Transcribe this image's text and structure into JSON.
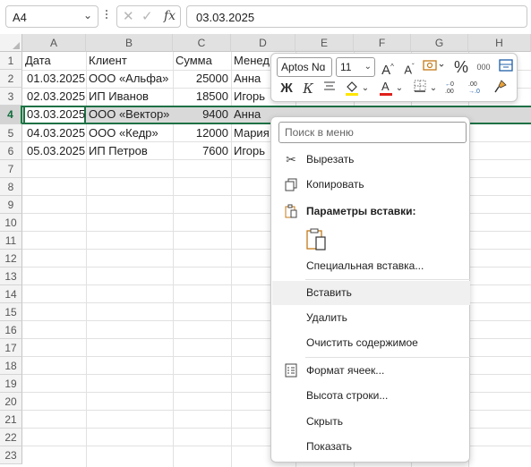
{
  "formula_bar": {
    "name_box": "A4",
    "fx_label": "fx",
    "cancel_glyph": "✕",
    "enter_glyph": "✓",
    "value": "03.03.2025"
  },
  "columns": [
    "A",
    "B",
    "C",
    "D",
    "E",
    "F",
    "G",
    "H"
  ],
  "rows": [
    "1",
    "2",
    "3",
    "4",
    "5",
    "6",
    "7",
    "8",
    "9",
    "10",
    "11",
    "12",
    "13",
    "14",
    "15",
    "16",
    "17",
    "18",
    "19",
    "20",
    "21",
    "22",
    "23"
  ],
  "table": {
    "header": {
      "a": "Дата",
      "b": "Клиент",
      "c": "Сумма",
      "d": "Менед"
    },
    "data": [
      {
        "a": "01.03.2025",
        "b": "ООО «Альфа»",
        "c": "25000",
        "d": "Анна"
      },
      {
        "a": "02.03.2025",
        "b": "ИП Иванов",
        "c": "18500",
        "d": "Игорь"
      },
      {
        "a": "03.03.2025",
        "b": "ООО «Вектор»",
        "c": "9400",
        "d": "Анна"
      },
      {
        "a": "04.03.2025",
        "b": "ООО «Кедр»",
        "c": "12000",
        "d": "Мария"
      },
      {
        "a": "05.03.2025",
        "b": "ИП Петров",
        "c": "7600",
        "d": "Игорь"
      }
    ]
  },
  "mini_toolbar": {
    "font_name": "Aptos Nɑ",
    "font_size": "11",
    "bold": "Ж",
    "italic": "К",
    "percent": "%",
    "thousands": "000",
    "font_color": "#e0201b",
    "fill_color": "#ffe600"
  },
  "context_menu": {
    "search_placeholder": "Поиск в меню",
    "items": {
      "cut": "Вырезать",
      "copy": "Копировать",
      "paste_options": "Параметры вставки:",
      "paste_special": "Специальная вставка...",
      "insert": "Вставить",
      "delete": "Удалить",
      "clear": "Очистить содержимое",
      "format_cells": "Формат ячеек...",
      "row_height": "Высота строки...",
      "hide": "Скрыть",
      "unhide": "Показать"
    }
  },
  "colors": {
    "accent_green": "#1e7145",
    "selection_gray": "#d9d9d9"
  }
}
